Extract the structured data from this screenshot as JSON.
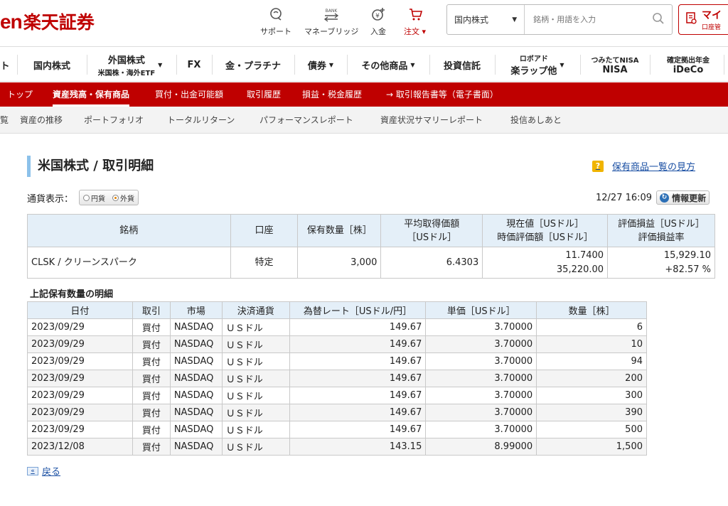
{
  "header": {
    "logo_latin": "en",
    "logo_jp": "楽天証券",
    "utilities": [
      {
        "label": "サポート",
        "icon": "support-icon"
      },
      {
        "label": "マネーブリッジ",
        "icon": "bank-bridge-icon",
        "icon_text": "BANK"
      },
      {
        "label": "入金",
        "icon": "deposit-icon"
      },
      {
        "label": "注文 ▾",
        "icon": "cart-icon"
      }
    ],
    "search": {
      "category": "国内株式",
      "placeholder": "銘柄・用語を入力"
    },
    "mypage": {
      "label": "マイ",
      "sub": "口座管"
    }
  },
  "product_nav": [
    {
      "label": "ト"
    },
    {
      "label": "国内株式"
    },
    {
      "label": "外国株式",
      "sub": "米国株・海外ETF"
    },
    {
      "label": "FX"
    },
    {
      "label": "金・プラチナ"
    },
    {
      "label": "債券"
    },
    {
      "label": "その他商品"
    },
    {
      "label": "投資信託"
    },
    {
      "label": "ロボアド",
      "sub": "楽ラップ他"
    },
    {
      "label": "つみたてNISA",
      "sub": "NISA"
    },
    {
      "label": "確定拠出年金",
      "sub": "iDeCo"
    }
  ],
  "red_nav": [
    {
      "label": "トップ"
    },
    {
      "label": "資産残高・保有商品"
    },
    {
      "label": "買付・出金可能額"
    },
    {
      "label": "取引履歴"
    },
    {
      "label": "損益・税金履歴"
    },
    {
      "label": "→ 取引報告書等（電子書面）"
    }
  ],
  "sub_nav": [
    {
      "label": "覧"
    },
    {
      "label": "資産の推移"
    },
    {
      "label": "ポートフォリオ"
    },
    {
      "label": "トータルリターン"
    },
    {
      "label": "パフォーマンスレポート"
    },
    {
      "label": "資産状況サマリーレポート"
    },
    {
      "label": "投信あしあと"
    }
  ],
  "page": {
    "title": "米国株式 / 取引明細",
    "help_link": "保有商品一覧の見方",
    "currency_label": "通貨表示：",
    "currency_options": [
      "円貨",
      "外貨"
    ],
    "currency_selected": "外貨",
    "timestamp": "12/27 16:09",
    "refresh_label": "情報更新"
  },
  "holding_table": {
    "headers": [
      "銘柄",
      "口座",
      "保有数量［株］",
      "平均取得価額",
      "［USドル］",
      "現在値［USドル］",
      "時価評価額［USドル］",
      "評価損益［USドル］",
      "評価損益率"
    ],
    "row": {
      "name": "CLSK / クリーンスパーク",
      "account": "特定",
      "quantity": "3,000",
      "avg_price": "6.4303",
      "current_price": "11.7400",
      "market_value": "35,220.00",
      "pnl": "15,929.10",
      "pnl_rate": "+82.57 %"
    }
  },
  "detail": {
    "subtitle": "上記保有数量の明細",
    "headers": [
      "日付",
      "取引",
      "市場",
      "決済通貨",
      "為替レート［USドル/円］",
      "単価［USドル］",
      "数量［株］"
    ],
    "rows": [
      [
        "2023/09/29",
        "買付",
        "NASDAQ",
        "ＵＳドル",
        "149.67",
        "3.70000",
        "6"
      ],
      [
        "2023/09/29",
        "買付",
        "NASDAQ",
        "ＵＳドル",
        "149.67",
        "3.70000",
        "10"
      ],
      [
        "2023/09/29",
        "買付",
        "NASDAQ",
        "ＵＳドル",
        "149.67",
        "3.70000",
        "94"
      ],
      [
        "2023/09/29",
        "買付",
        "NASDAQ",
        "ＵＳドル",
        "149.67",
        "3.70000",
        "200"
      ],
      [
        "2023/09/29",
        "買付",
        "NASDAQ",
        "ＵＳドル",
        "149.67",
        "3.70000",
        "300"
      ],
      [
        "2023/09/29",
        "買付",
        "NASDAQ",
        "ＵＳドル",
        "149.67",
        "3.70000",
        "390"
      ],
      [
        "2023/09/29",
        "買付",
        "NASDAQ",
        "ＵＳドル",
        "149.67",
        "3.70000",
        "500"
      ],
      [
        "2023/12/08",
        "買付",
        "NASDAQ",
        "ＵＳドル",
        "143.15",
        "8.99000",
        "1,500"
      ]
    ]
  },
  "back_link": "戻る",
  "colors": {
    "brand_red": "#bf0000",
    "header_cell": "#e4eff8",
    "title_bar": "#8cc1ea",
    "link": "#1a4fa3"
  }
}
